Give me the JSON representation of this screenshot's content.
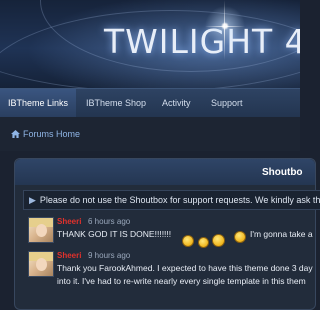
{
  "header": {
    "logo_text": "TWILIGHT 4"
  },
  "nav": {
    "items": [
      {
        "label": "IBTheme Links",
        "active": true
      },
      {
        "label": "IBTheme Shop",
        "active": false
      },
      {
        "label": "Activity",
        "active": false
      },
      {
        "label": "Support",
        "active": false
      }
    ]
  },
  "breadcrumb": {
    "icon": "home-icon",
    "label": "Forums Home"
  },
  "shoutbox": {
    "title": "Shoutbo",
    "notice_icon": "megaphone-icon",
    "notice": "Please do not use the Shoutbox for support requests. We kindly ask th",
    "shouts": [
      {
        "name": "Sheeri",
        "time": "6 hours ago",
        "text": "THANK GOD IT IS DONE!!!!!!!",
        "text_after": "I'm gonna take a"
      },
      {
        "name": "Sheeri",
        "time": "9 hours ago",
        "text": "Thank you FarookAhmed. I expected to have this theme done 3 day",
        "text_line2": "into it. I've had to re-write nearly every single template in this them"
      }
    ]
  },
  "colors": {
    "accent": "#8fb5e6",
    "username": "#e0312c",
    "navbar": "#2a3f60"
  }
}
